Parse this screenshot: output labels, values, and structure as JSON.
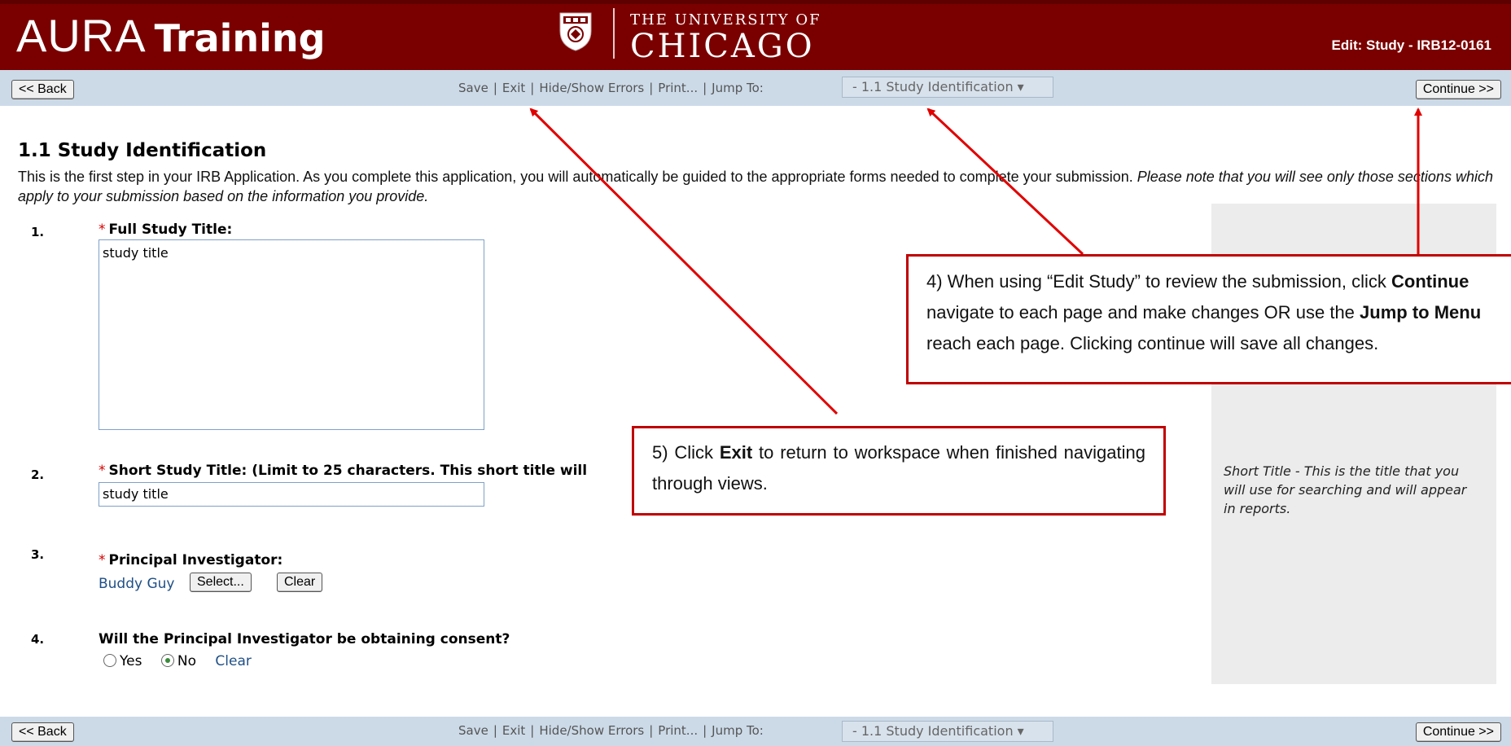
{
  "header": {
    "app_title_main": "AURA",
    "app_title_sub": "Training",
    "university_line1": "THE UNIVERSITY OF",
    "university_line2": "CHICAGO",
    "edit_label": "Edit: Study - IRB12-0161",
    "crest_icon": "university-crest-icon"
  },
  "toolbar": {
    "back_label": "<< Back",
    "continue_label": "Continue >>",
    "save_label": "Save",
    "exit_label": "Exit",
    "errors_label": "Hide/Show Errors",
    "print_label": "Print...",
    "jump_to_label": "Jump To:",
    "jump_selected": "- 1.1 Study Identification ▾"
  },
  "section": {
    "title": "1.1 Study Identification",
    "intro_plain": "This is the first step in your IRB Application.  As you complete this application, you will automatically be guided to the appropriate forms needed to complete your submission.  ",
    "intro_italic": "Please note that you will see only those sections which apply to your submission based on the information you provide."
  },
  "questions": [
    {
      "num": "1.",
      "required_mark": "*",
      "label": "Full Study Title:",
      "value": "study title"
    },
    {
      "num": "2.",
      "required_mark": "*",
      "label": "Short Study Title: (Limit to 25 characters.  This short title will",
      "value": "study title"
    },
    {
      "num": "3.",
      "required_mark": "*",
      "label": "Principal Investigator:",
      "value": "Buddy Guy",
      "select_label": "Select...",
      "clear_label": "Clear"
    },
    {
      "num": "4.",
      "label": "Will the Principal Investigator be obtaining consent?",
      "yes_label": "Yes",
      "no_label": "No",
      "clear_label": "Clear",
      "selected": "No"
    }
  ],
  "help": {
    "short_title_help": "Short Title - This is the title that you will use for searching and will appear in reports."
  },
  "callouts": {
    "four": {
      "line1_a": "4) When using “Edit Study” to review the submission, click ",
      "line1_b": "Continue",
      "line2_a": "navigate to each page and make changes OR use the ",
      "line2_b": "Jump to Menu",
      "line3": "reach each page.  Clicking continue will save all changes."
    },
    "five": {
      "a": "5) Click ",
      "b": "Exit",
      "c": " to return to workspace when finished navigating through views."
    }
  },
  "colors": {
    "header_bg": "#7a0000",
    "toolbar_bg": "#ccdae8",
    "callout_border": "#c00000",
    "arrow": "#e00000"
  }
}
